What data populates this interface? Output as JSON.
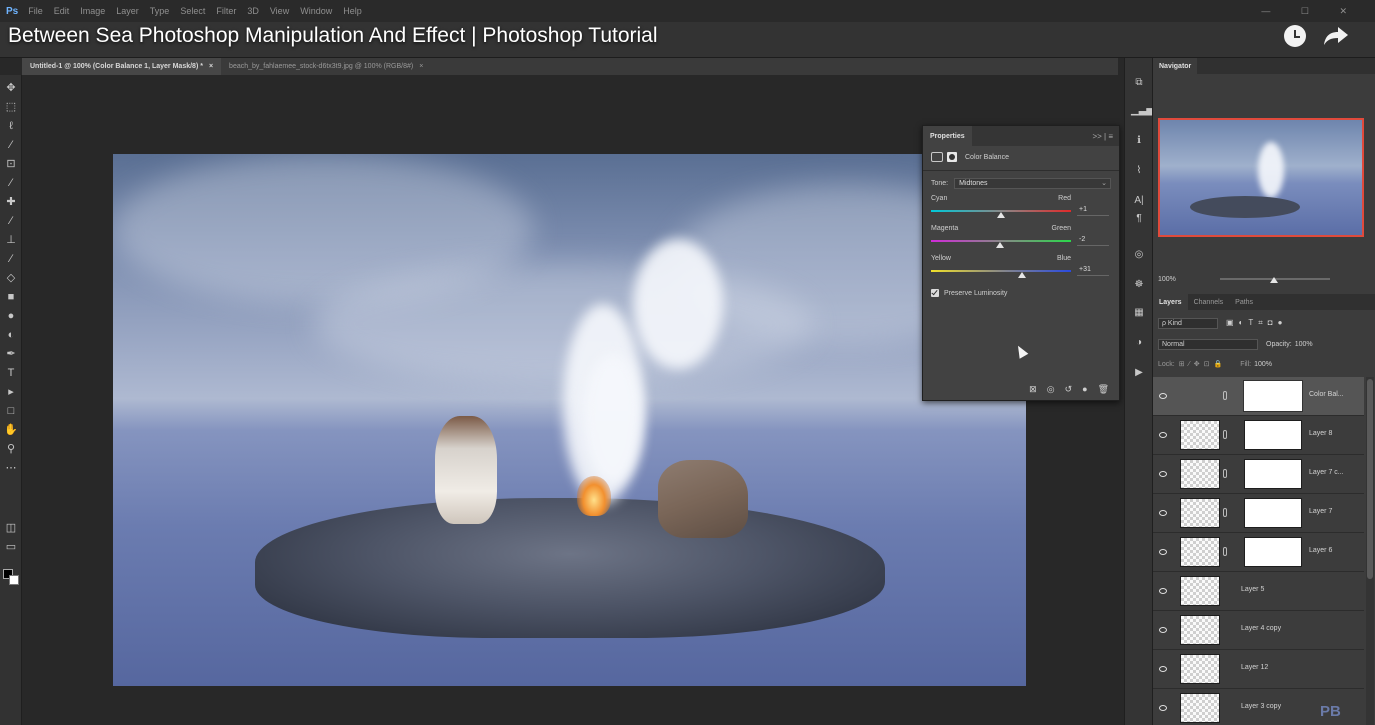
{
  "menubar": {
    "logo": "Ps",
    "items": [
      "File",
      "Edit",
      "Image",
      "Layer",
      "Type",
      "Select",
      "Filter",
      "3D",
      "View",
      "Window",
      "Help"
    ],
    "controls": "— ☐ ✕"
  },
  "video": {
    "title": "Between Sea Photoshop Manipulation And Effect | Photoshop Tutorial"
  },
  "tabs": [
    {
      "label": "Untitled-1 @ 100% (Color Balance 1, Layer Mask/8) *",
      "close": "×"
    },
    {
      "label": "beach_by_fahlaemee_stock-d6tx3t9.jpg @ 100% (RGB/8#)",
      "close": "×"
    }
  ],
  "properties": {
    "tab": "Properties",
    "menu_icons": ">> | ≡",
    "title": "Color Balance",
    "tone_label": "Tone:",
    "tone_value": "Midtones",
    "sliders": [
      {
        "left": "Cyan",
        "right": "Red",
        "value": "+1",
        "position": 0.5,
        "colors": [
          "#00c8d8",
          "#e02a2a"
        ]
      },
      {
        "left": "Magenta",
        "right": "Green",
        "value": "-2",
        "position": 0.49,
        "colors": [
          "#d02ad8",
          "#2ad84a"
        ]
      },
      {
        "left": "Yellow",
        "right": "Blue",
        "value": "+31",
        "position": 0.65,
        "colors": [
          "#f0e02a",
          "#2a4ae0"
        ]
      }
    ],
    "preserve_label": "Preserve Luminosity",
    "preserve_checked": true,
    "footer_icons": [
      "⊠",
      "◎",
      "↺",
      "●",
      "🗑"
    ]
  },
  "navigator": {
    "tab": "Navigator",
    "zoom": "100%"
  },
  "layers_panel": {
    "tabs": [
      "Layers",
      "Channels",
      "Paths"
    ],
    "kind_label": "ρ Kind",
    "blend_mode": "Normal",
    "opacity_label": "Opacity:",
    "opacity_value": "100%",
    "lock_label": "Lock:",
    "fill_label": "Fill:",
    "fill_value": "100%",
    "layers": [
      {
        "name": "Color Bal...",
        "selected": true,
        "has_mask": true,
        "adjustment": true
      },
      {
        "name": "Layer 8",
        "selected": false,
        "has_mask": true,
        "adjustment": false
      },
      {
        "name": "Layer 7 c...",
        "selected": false,
        "has_mask": true,
        "adjustment": false
      },
      {
        "name": "Layer 7",
        "selected": false,
        "has_mask": true,
        "adjustment": false
      },
      {
        "name": "Layer 6",
        "selected": false,
        "has_mask": true,
        "adjustment": false
      },
      {
        "name": "Layer 5",
        "selected": false,
        "has_mask": false,
        "adjustment": false
      },
      {
        "name": "Layer 4 copy",
        "selected": false,
        "has_mask": false,
        "adjustment": false
      },
      {
        "name": "Layer 12",
        "selected": false,
        "has_mask": false,
        "adjustment": false
      },
      {
        "name": "Layer 3 copy",
        "selected": false,
        "has_mask": false,
        "adjustment": false
      }
    ]
  },
  "watermark": "PB",
  "icons": {
    "tools": [
      "move-icon",
      "marquee-icon",
      "lasso-icon",
      "quick-select-icon",
      "crop-icon",
      "eyedropper-icon",
      "healing-icon",
      "brush-icon",
      "stamp-icon",
      "history-brush-icon",
      "eraser-icon",
      "gradient-icon",
      "blur-icon",
      "dodge-icon",
      "pen-icon",
      "type-icon",
      "path-select-icon",
      "rectangle-icon",
      "hand-icon",
      "zoom-icon",
      "more-tools-icon"
    ]
  }
}
